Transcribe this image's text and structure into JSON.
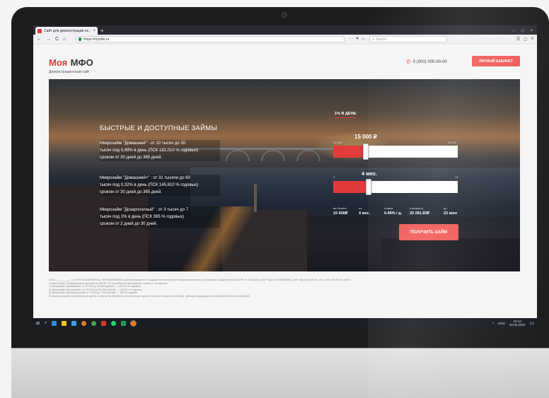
{
  "browser": {
    "tab_title": "Сайт для демонстрации се...",
    "tab_close": "×",
    "new_tab": "+",
    "window_controls": [
      "–",
      "□",
      "×"
    ],
    "nav": [
      "←",
      "→",
      "C",
      "⌂"
    ],
    "url": "https://mymfo.ru",
    "url_icons": [
      "···",
      "♥",
      "☆"
    ],
    "search_placeholder": "Search",
    "right_icons": [
      "|||",
      "▢",
      "≡"
    ]
  },
  "header": {
    "logo_part1": "Моя",
    "logo_part2": "МФО",
    "logo_sub": "Демонстрационный сайт",
    "phone_icon": "✆",
    "phone": "0 (000) 000-00-00",
    "cabinet_button": "ЛИЧНЫЙ КАБИНЕТ"
  },
  "hero": {
    "title": "БЫСТРЫЕ И ДОСТУПНЫЕ ЗАЙМЫ",
    "offers": [
      [
        "Микрозайм \"Домашний\" : от 10 тысяч до 30",
        "тысяч под 0,49% в день (ПСК 182,010 % годовых)",
        "сроком от 30 дней до 365 дней."
      ],
      [
        "Микрозайм \"Домашний+\" : от 31 тысячи до 60",
        "тысяч под 0,32% в день (ПСК 145,610 % годовых)",
        "сроком от 30 дней до 365 дней."
      ],
      [
        "Микрозайм \"Дозарплатный\" : от 3 тысяч до 7",
        "тысяч под 1% в день (ПСК 365 % годовых)",
        "сроком от 2 дней до 30 дней."
      ]
    ]
  },
  "calculator": {
    "rate_tab": "1% В ДЕНЬ",
    "amount_display": "15 000 ₽",
    "amount_min": "10 000",
    "amount_max": "30 000",
    "amount_fraction": 0.25,
    "term_display": "4 мес.",
    "term_min": "1",
    "term_max": "12",
    "term_fraction": 0.27,
    "summary": [
      {
        "label": "вы берете",
        "value": "15 000₽"
      },
      {
        "label": "на",
        "value": "4 мес."
      },
      {
        "label": "ставка",
        "value": "0.49% / д."
      },
      {
        "label": "к возврату",
        "value": "20 281.83₽"
      },
      {
        "label": "до",
        "value": "23 июн"
      }
    ],
    "submit": "ПОЛУЧИТЬ ЗАЙМ"
  },
  "footer": {
    "lines": [
      "ООО «__________» (ОГРН 0000000000000, ИНН 0000000000) зарегистрировано в государственном реестре микрофинансовых организаций (Свидетельство ЦБ РФ от 16 августа 2017 года № 0000000000), сайт https://mymfo.ru, тел. 0 000 000-00-00. 000 в",
      "соответствии с Федеральным законом № 353-ФЗ «О потребительском кредите (займе)» составляет:",
      "1) Микрозайм «Домашний» от 10 000 до 30 000 рублей — 182,010 % годовых;",
      "2) Микрозайм «Домашний+» от 31 000 до 60 000 рублей — 145,610 % годовых;",
      "3) Микрозайм «Дозарплатный» от 3 000 до 7 000 рублей — 365 % годовых.",
      "Пользуясь нашими сервисами вы даете согласие на обработку персональных данных согласно правилу политики. Данная информация не является публичной офертой."
    ]
  },
  "taskbar": {
    "start": "⊞",
    "search": "⌕",
    "tray_arrow": "^",
    "lang": "ENG",
    "time": "15:13",
    "date": "02.03.2020",
    "notif": "▭"
  },
  "colors": {
    "accent": "#e23b3b",
    "button": "#f05a57"
  }
}
